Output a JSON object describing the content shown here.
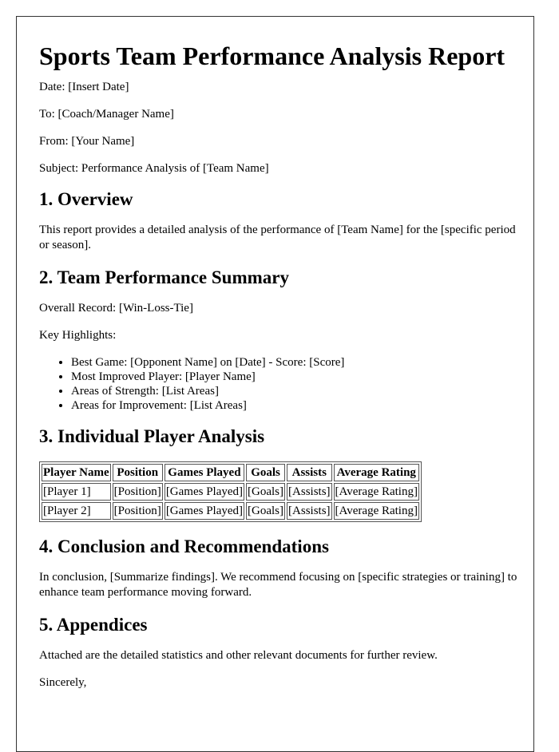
{
  "title": "Sports Team Performance Analysis Report",
  "meta": {
    "date": "Date: [Insert Date]",
    "to": "To: [Coach/Manager Name]",
    "from": "From: [Your Name]",
    "subject": "Subject: Performance Analysis of [Team Name]"
  },
  "sections": {
    "overview": {
      "heading": "1. Overview",
      "text": "This report provides a detailed analysis of the performance of [Team Name] for the [specific period or season]."
    },
    "summary": {
      "heading": "2. Team Performance Summary",
      "record": "Overall Record: [Win-Loss-Tie]",
      "highlights_label": "Key Highlights:",
      "highlights": [
        "Best Game: [Opponent Name] on [Date] - Score: [Score]",
        "Most Improved Player: [Player Name]",
        "Areas of Strength: [List Areas]",
        "Areas for Improvement: [List Areas]"
      ]
    },
    "players": {
      "heading": "3. Individual Player Analysis",
      "columns": [
        "Player Name",
        "Position",
        "Games Played",
        "Goals",
        "Assists",
        "Average Rating"
      ],
      "rows": [
        [
          "[Player 1]",
          "[Position]",
          "[Games Played]",
          "[Goals]",
          "[Assists]",
          "[Average Rating]"
        ],
        [
          "[Player 2]",
          "[Position]",
          "[Games Played]",
          "[Goals]",
          "[Assists]",
          "[Average Rating]"
        ]
      ]
    },
    "conclusion": {
      "heading": "4. Conclusion and Recommendations",
      "text": "In conclusion, [Summarize findings]. We recommend focusing on [specific strategies or training] to enhance team performance moving forward."
    },
    "appendices": {
      "heading": "5. Appendices",
      "text": "Attached are the detailed statistics and other relevant documents for further review."
    }
  },
  "closing": "Sincerely,"
}
